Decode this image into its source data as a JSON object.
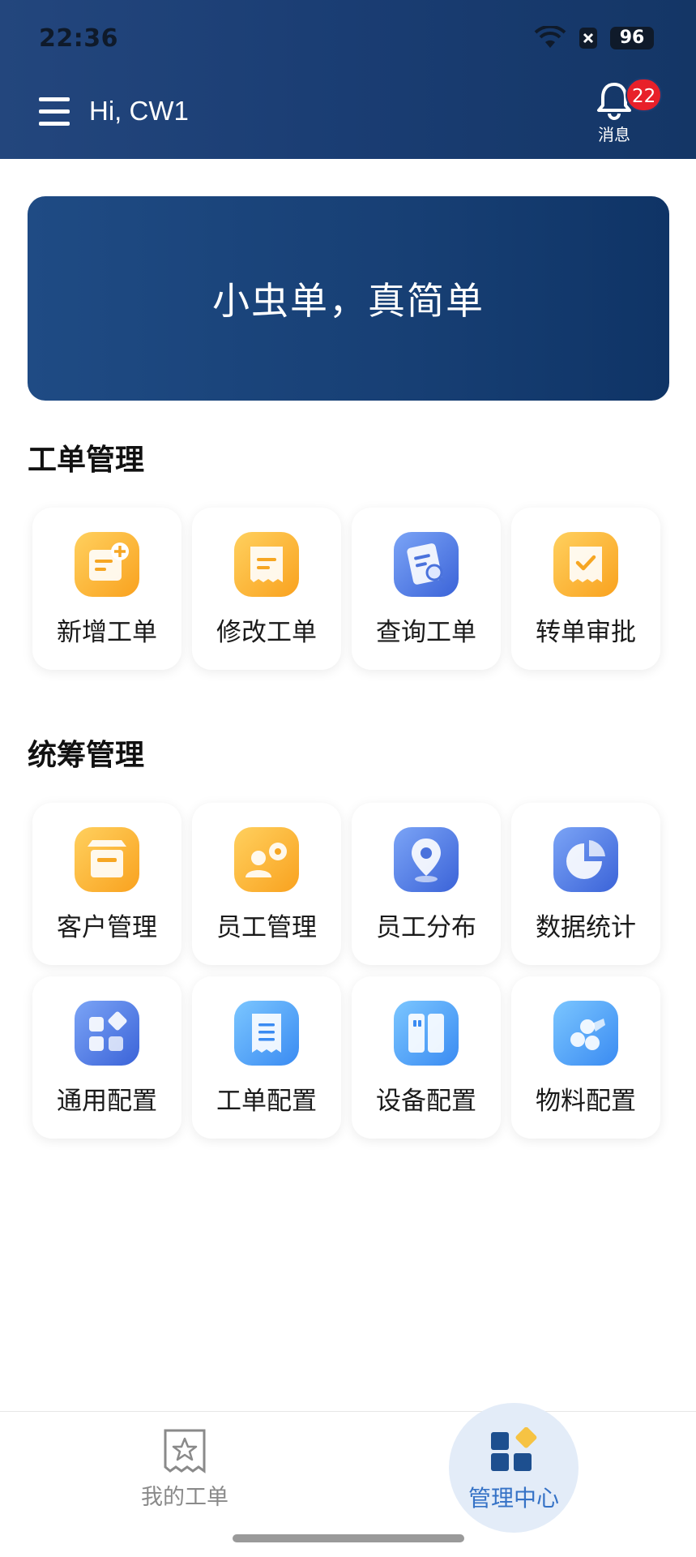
{
  "status": {
    "time": "22:36",
    "battery": "96"
  },
  "header": {
    "greeting": "Hi, CW1",
    "notifications_label": "消息",
    "notifications_count": "22"
  },
  "banner": {
    "slogan": "小虫单，真简单"
  },
  "sections": {
    "work_orders": {
      "title": "工单管理",
      "items": [
        {
          "label": "新增工单",
          "icon": "add-document-icon"
        },
        {
          "label": "修改工单",
          "icon": "edit-document-icon"
        },
        {
          "label": "查询工单",
          "icon": "search-document-icon"
        },
        {
          "label": "转单审批",
          "icon": "approval-document-icon"
        }
      ]
    },
    "planning": {
      "title": "统筹管理",
      "items": [
        {
          "label": "客户管理",
          "icon": "store-icon"
        },
        {
          "label": "员工管理",
          "icon": "employee-settings-icon"
        },
        {
          "label": "员工分布",
          "icon": "location-pin-icon"
        },
        {
          "label": "数据统计",
          "icon": "pie-chart-icon"
        },
        {
          "label": "通用配置",
          "icon": "grid-config-icon"
        },
        {
          "label": "工单配置",
          "icon": "order-config-icon"
        },
        {
          "label": "设备配置",
          "icon": "device-config-icon"
        },
        {
          "label": "物料配置",
          "icon": "material-config-icon"
        }
      ]
    }
  },
  "bottom_nav": {
    "mine_label": "我的工单",
    "mgmt_label": "管理中心"
  },
  "colors": {
    "header": "#1c3f74",
    "accent": "#3572c6",
    "badge": "#e8202a"
  }
}
